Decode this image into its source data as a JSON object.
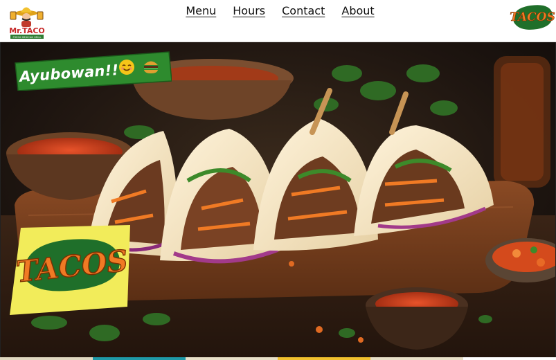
{
  "header": {
    "logo_left_text": "Mr.TACO",
    "logo_left_subtext": "FRESH MEXICAN GRILL",
    "logo_right_text": "TACOS",
    "nav": [
      {
        "label": "Menu"
      },
      {
        "label": "Hours"
      },
      {
        "label": "Contact"
      },
      {
        "label": "About"
      }
    ]
  },
  "hero": {
    "greeting": "Ayubowan!!",
    "greeting_emojis": [
      "smiling-face-icon",
      "burger-icon"
    ],
    "promo_card_text": "TACOS"
  },
  "colors": {
    "greeting_banner": "#2e8b2e",
    "promo_card_bg": "#f2ec5a",
    "tacos_orange": "#f07a24",
    "tacos_green": "#1f6f2a",
    "wood": "#6b3a1e"
  }
}
